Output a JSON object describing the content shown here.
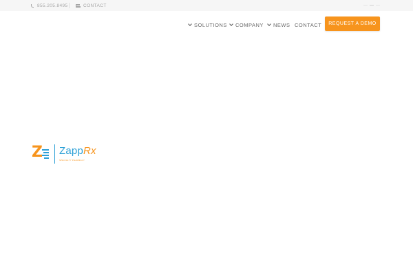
{
  "topbar": {
    "phone": "855.205.8495",
    "contact": "CONTACT"
  },
  "nav": {
    "items": [
      {
        "label": "SOLUTIONS",
        "has_dropdown": true
      },
      {
        "label": "COMPANY",
        "has_dropdown": true
      },
      {
        "label": "NEWS",
        "has_dropdown": true
      },
      {
        "label": "CONTACT",
        "has_dropdown": false
      }
    ],
    "cta": "REQUEST A DEMO"
  },
  "logo": {
    "mark": "Z",
    "name_part1": "Zapp",
    "name_part2": "Rx",
    "tagline": "SPECIALTY PHARMACY"
  },
  "colors": {
    "accent": "#f7941d",
    "brand_blue": "#2a9fd6",
    "topbar_bg": "#f6f6f6",
    "nav_text": "#6a6a6a"
  }
}
